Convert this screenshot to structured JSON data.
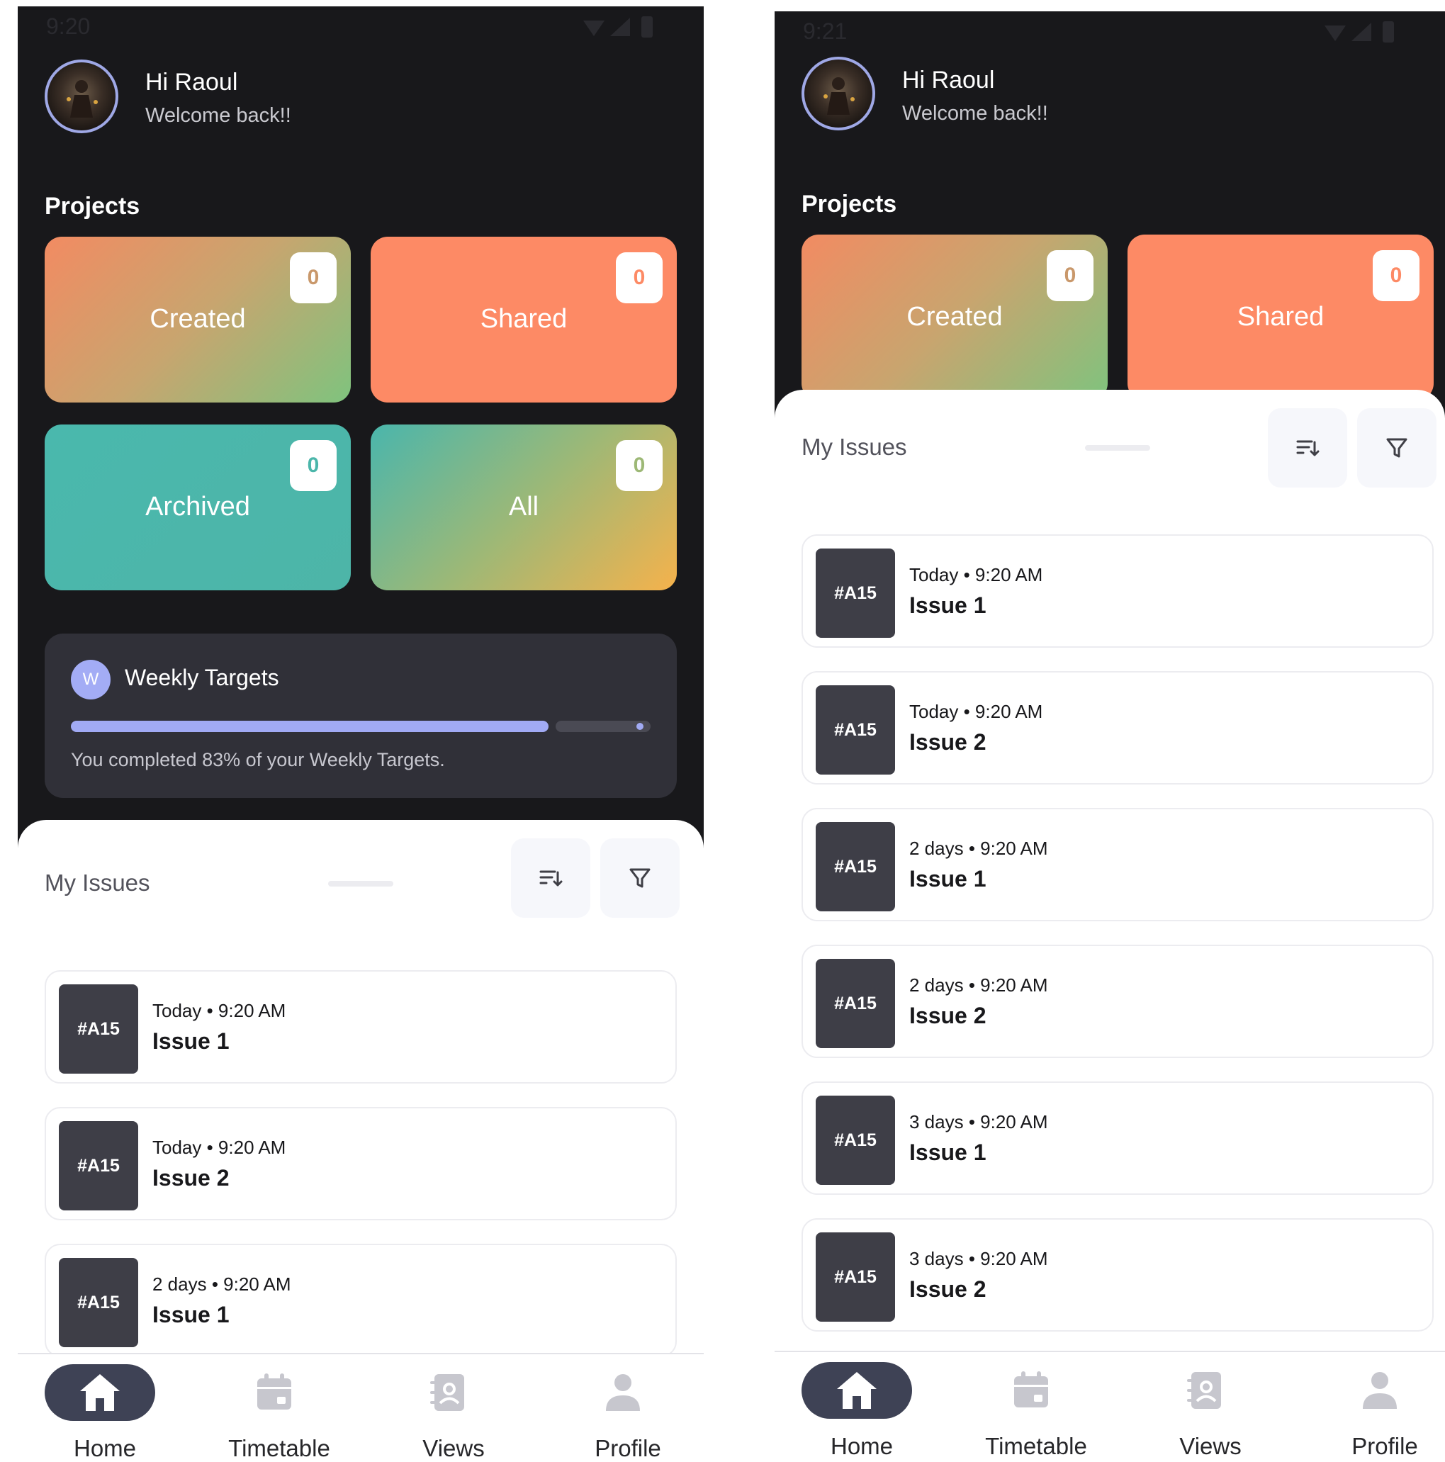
{
  "screens": [
    {
      "status_time": "9:20",
      "greeting": "Hi Raoul",
      "welcome": "Welcome back!!",
      "projects_title": "Projects",
      "cards": [
        {
          "label": "Created",
          "count": "0",
          "count_color": "#c9986b"
        },
        {
          "label": "Shared",
          "count": "0",
          "count_color": "#fd8a65"
        },
        {
          "label": "Archived",
          "count": "0",
          "count_color": "#4bb6aa"
        },
        {
          "label": "All",
          "count": "0",
          "count_color": "#9db876"
        }
      ],
      "weekly_targets": {
        "badge": "W",
        "title": "Weekly Targets",
        "progress_percent": 83,
        "caption": "You completed 83% of your Weekly Targets."
      },
      "my_issues_title": "My Issues",
      "issues": [
        {
          "id": "#A15",
          "meta": "Today • 9:20 AM",
          "title": "Issue 1"
        },
        {
          "id": "#A15",
          "meta": "Today • 9:20 AM",
          "title": "Issue 2"
        },
        {
          "id": "#A15",
          "meta": "2 days • 9:20 AM",
          "title": "Issue 1"
        }
      ],
      "nav": [
        "Home",
        "Timetable",
        "Views",
        "Profile"
      ]
    },
    {
      "status_time": "9:21",
      "greeting": "Hi Raoul",
      "welcome": "Welcome back!!",
      "projects_title": "Projects",
      "cards": [
        {
          "label": "Created",
          "count": "0",
          "count_color": "#c9986b"
        },
        {
          "label": "Shared",
          "count": "0",
          "count_color": "#fd8a65"
        }
      ],
      "my_issues_title": "My Issues",
      "issues": [
        {
          "id": "#A15",
          "meta": "Today • 9:20 AM",
          "title": "Issue 1"
        },
        {
          "id": "#A15",
          "meta": "Today • 9:20 AM",
          "title": "Issue 2"
        },
        {
          "id": "#A15",
          "meta": "2 days • 9:20 AM",
          "title": "Issue 1"
        },
        {
          "id": "#A15",
          "meta": "2 days • 9:20 AM",
          "title": "Issue 2"
        },
        {
          "id": "#A15",
          "meta": "3 days • 9:20 AM",
          "title": "Issue 1"
        },
        {
          "id": "#A15",
          "meta": "3 days • 9:20 AM",
          "title": "Issue 2"
        }
      ],
      "nav": [
        "Home",
        "Timetable",
        "Views",
        "Profile"
      ]
    }
  ],
  "icons": {
    "sort": "sort-icon",
    "filter": "filter-icon",
    "home": "home-icon",
    "timetable": "calendar-icon",
    "views": "contact-book-icon",
    "profile": "person-icon"
  }
}
